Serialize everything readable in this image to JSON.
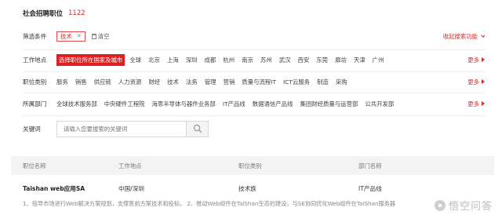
{
  "header": {
    "title": "社会招聘职位",
    "count": "1122"
  },
  "filter": {
    "label": "筛选条件",
    "tag": "技术",
    "clear_label": "清空",
    "collapse_label": "收起搜索功能"
  },
  "location": {
    "label": "工作地点",
    "active": "选择职位所在国家及城市",
    "items": [
      "全球",
      "北京",
      "上海",
      "深圳",
      "成都",
      "杭州",
      "南京",
      "苏州",
      "武汉",
      "西安",
      "东莞",
      "廊坊",
      "天津",
      "广州"
    ],
    "more": "更多"
  },
  "category": {
    "label": "职位类别",
    "items": [
      "服务",
      "销售",
      "供应链",
      "人力资源",
      "财经",
      "技术",
      "法务",
      "管理",
      "营销",
      "质量与流程IT",
      "ICT云服务",
      "制造",
      "采购"
    ],
    "more": "更多"
  },
  "department": {
    "label": "所属部门",
    "items": [
      "全球技术服务部",
      "中央硬件工程院",
      "海思半导体与器件业务部",
      "IT产品线",
      "数据通信产品线",
      "集团财经质量与运营部",
      "公共开发部"
    ],
    "more": "更多"
  },
  "keyword": {
    "label": "关键词",
    "placeholder": "请输入您要搜索的关键词"
  },
  "table": {
    "headers": [
      "职位名称",
      "工作地点",
      "职位类别",
      "部门名称"
    ],
    "row": {
      "title": "Taishan web应用SA",
      "location": "中国/深圳",
      "category": "技术族",
      "department": "IT产品线",
      "description": "1、指导市场进行Web解决方案规划，支撑售前方案技术和投标。 2、推动Web组件在TaiShan生态的建设，与SE协同优化Web组件在TaiShan服务器"
    }
  },
  "watermark": {
    "text": "悟空问答"
  },
  "colors": {
    "accent": "#e02020",
    "accent_text": "#d62b2b",
    "table_header_bg": "#f3f3f3"
  }
}
